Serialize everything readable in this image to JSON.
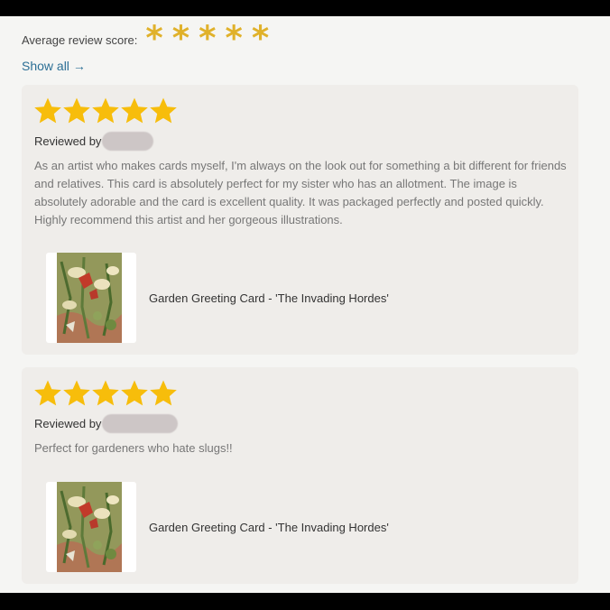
{
  "summary": {
    "label": "Average review score:",
    "rating": 5,
    "star_glyph": "*",
    "star_color": "#e0b12a"
  },
  "show_all": {
    "label": "Show all",
    "arrow": "→"
  },
  "reviews": [
    {
      "rating": 5,
      "reviewed_by_label": "Reviewed by",
      "reviewer_name_hidden": true,
      "text": "As an artist who makes cards myself, I'm always on the look out for something a bit different for friends and relatives. This card is absolutely perfect for my sister who has an allotment. The image is absolutely adorable and the card is excellent quality. It was packaged perfectly and posted quickly. Highly recommend this artist and her gorgeous illustrations.",
      "product": {
        "name": "Garden Greeting Card - 'The Invading Hordes'",
        "icon": "garden-card-thumbnail"
      }
    },
    {
      "rating": 5,
      "reviewed_by_label": "Reviewed by",
      "reviewer_name_hidden": true,
      "text": "Perfect for gardeners who hate slugs!!",
      "product": {
        "name": "Garden Greeting Card - 'The Invading Hordes'",
        "icon": "garden-card-thumbnail"
      }
    }
  ],
  "colors": {
    "star_fill": "#f7bd0b",
    "link": "#2c6f95",
    "card_bg": "#efedea",
    "page_bg": "#f5f5f3"
  }
}
